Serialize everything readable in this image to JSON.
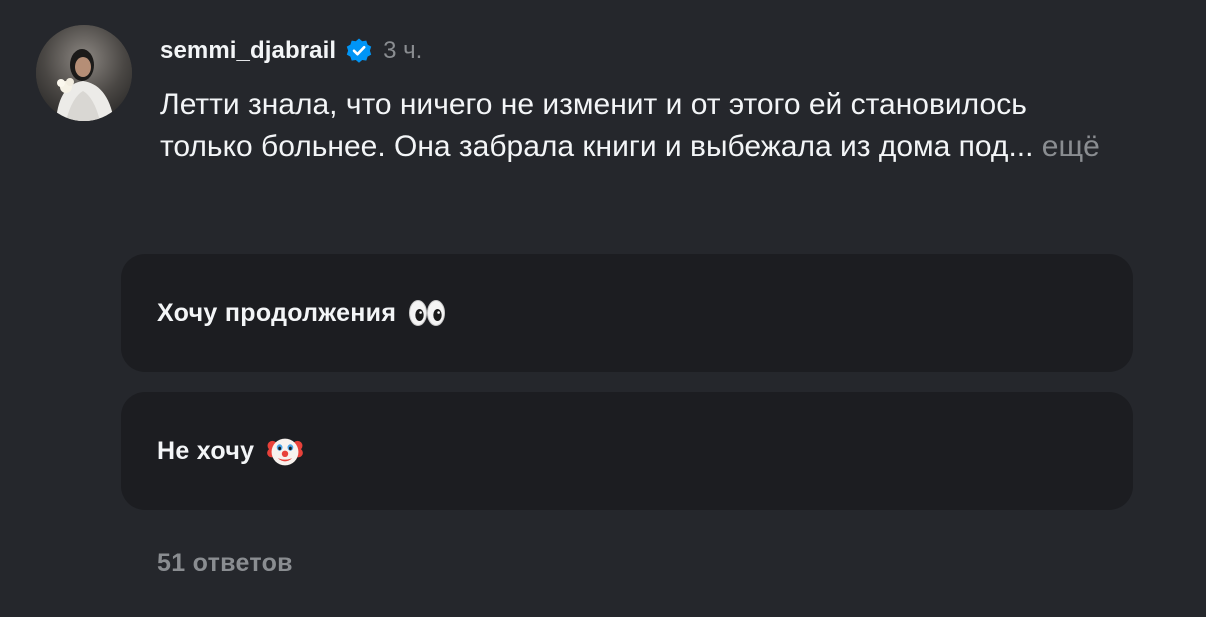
{
  "post": {
    "username": "semmi_djabrail",
    "verified_icon": "verified-badge-icon",
    "time": "3 ч.",
    "caption": "Летти знала, что ничего не изменит и от этого ей становилось только больнее. Она забрала книги и выбежала из дома под...",
    "more_label": "ещё"
  },
  "poll": {
    "options": [
      {
        "label": "Хочу продолжения",
        "emoji": "eyes-emoji-icon"
      },
      {
        "label": "Не хочу",
        "emoji": "clown-face-emoji-icon"
      }
    ]
  },
  "footer": {
    "replies_label": "51 ответов"
  },
  "colors": {
    "background": "#25272c",
    "option_background": "#1c1d21",
    "text_primary": "#f3f5f7",
    "text_secondary": "#8a8d91",
    "verified_blue": "#0095f6"
  }
}
